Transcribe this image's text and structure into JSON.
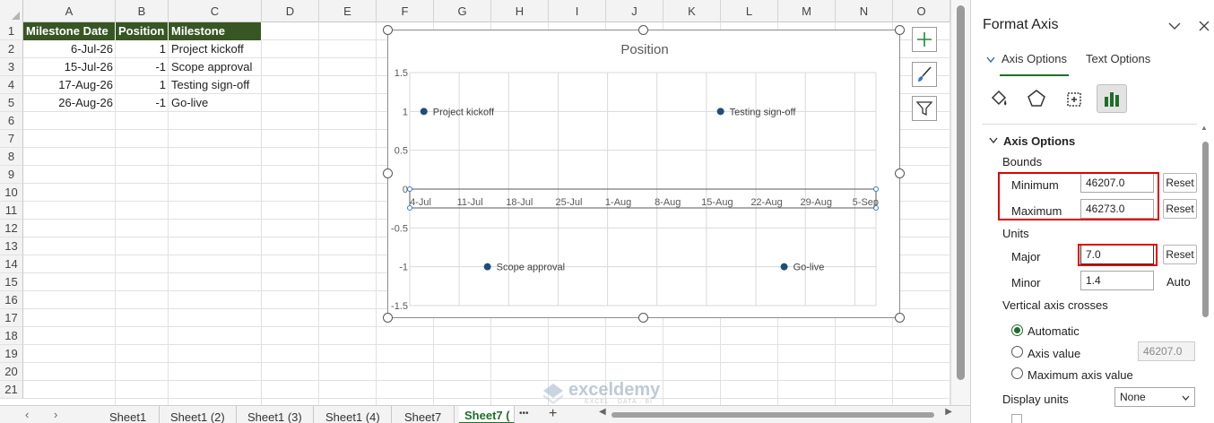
{
  "sheet": {
    "columns": [
      "A",
      "B",
      "C",
      "D",
      "E",
      "F",
      "G",
      "H",
      "I",
      "J",
      "K",
      "L",
      "M",
      "N",
      "O"
    ],
    "rows": [
      "1",
      "2",
      "3",
      "4",
      "5",
      "6",
      "7",
      "8",
      "9",
      "10",
      "11",
      "12",
      "13",
      "14",
      "15",
      "16",
      "17",
      "18",
      "19",
      "20",
      "21"
    ],
    "headers": {
      "date": "Milestone Date",
      "position": "Position",
      "milestone": "Milestone"
    },
    "data": [
      {
        "date": "6-Jul-26",
        "position": "1",
        "milestone": "Project kickoff"
      },
      {
        "date": "15-Jul-26",
        "position": "-1",
        "milestone": "Scope approval"
      },
      {
        "date": "17-Aug-26",
        "position": "1",
        "milestone": "Testing sign-off"
      },
      {
        "date": "26-Aug-26",
        "position": "-1",
        "milestone": "Go-live"
      }
    ],
    "header_color": "#375623"
  },
  "chart_data": {
    "type": "scatter",
    "title": "Position",
    "x_tick_labels": [
      "4-Jul",
      "11-Jul",
      "18-Jul",
      "25-Jul",
      "1-Aug",
      "8-Aug",
      "15-Aug",
      "22-Aug",
      "29-Aug",
      "5-Sep"
    ],
    "x_serial_min": 46207,
    "x_serial_max": 46273,
    "x_major_unit": 7,
    "y_ticks": [
      "1.5",
      "1",
      "0.5",
      "0",
      "-0.5",
      "-1",
      "-1.5"
    ],
    "ylim": [
      -1.5,
      1.5
    ],
    "points": [
      {
        "x": "6-Jul-26",
        "x_serial": 46209,
        "y": 1,
        "label": "Project kickoff"
      },
      {
        "x": "15-Jul-26",
        "x_serial": 46218,
        "y": -1,
        "label": "Scope approval"
      },
      {
        "x": "17-Aug-26",
        "x_serial": 46251,
        "y": 1,
        "label": "Testing sign-off"
      },
      {
        "x": "26-Aug-26",
        "x_serial": 46260,
        "y": -1,
        "label": "Go-live"
      }
    ],
    "marker_color": "#1f4e79",
    "grid": true
  },
  "tabs": {
    "items": [
      "Sheet1",
      "Sheet1 (2)",
      "Sheet1 (3)",
      "Sheet1 (4)",
      "Sheet7",
      "Sheet7 ("
    ],
    "active_index": 5,
    "more": "•••",
    "add": "+"
  },
  "watermark": {
    "name": "exceldemy",
    "tagline": "EXCEL · DATA · BI"
  },
  "pane": {
    "title": "Format Axis",
    "tab_axis": "Axis Options",
    "tab_text": "Text Options",
    "section": "Axis Options",
    "bounds_label": "Bounds",
    "minimum_label": "Minimum",
    "minimum_value": "46207.0",
    "maximum_label": "Maximum",
    "maximum_value": "46273.0",
    "reset": "Reset",
    "units_label": "Units",
    "major_label": "Major",
    "major_value": "7.0",
    "minor_label": "Minor",
    "minor_value": "1.4",
    "auto": "Auto",
    "crosses_label": "Vertical axis crosses",
    "opt_automatic": "Automatic",
    "opt_axis_value": "Axis value",
    "axis_value": "46207.0",
    "opt_max": "Maximum axis value",
    "display_units_label": "Display units",
    "display_units_value": "None",
    "accent": "#1e6e2a",
    "highlight": "#e00000"
  }
}
